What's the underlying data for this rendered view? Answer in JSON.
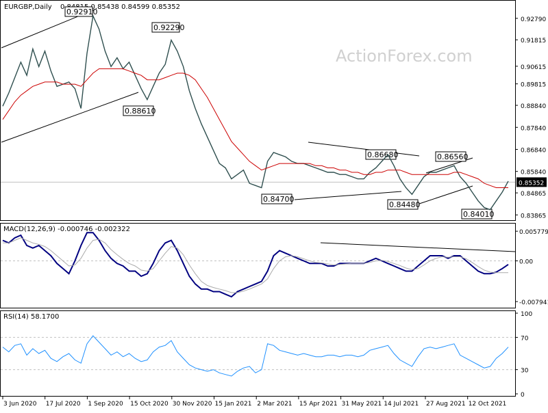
{
  "header": {
    "symbol": "EURGBP,Daily",
    "ohlc": "0.84815 0.85438 0.84599 0.85352"
  },
  "watermark": "ActionForex.com",
  "colors": {
    "price": "#2f4f4f",
    "ma": "#cc0000",
    "macd": "#000080",
    "signal": "#aaaaaa",
    "rsi": "#1e90ff",
    "trend": "#000000",
    "grid": "#c0c0c0",
    "current_box": "#000000"
  },
  "chart_data": [
    {
      "type": "line",
      "panel": "price",
      "ylim": [
        0.8375,
        0.9325
      ],
      "ticks": [
        "0.92790",
        "0.91815",
        "0.90615",
        "0.89815",
        "0.88840",
        "0.87840",
        "0.86840",
        "0.85840",
        "0.84865",
        "0.83865"
      ],
      "current_label": "0.85352",
      "callouts": [
        "0.92910",
        "0.92290",
        "0.88610",
        "0.86680",
        "0.86560",
        "0.84700",
        "0.84480",
        "0.84010"
      ],
      "series": [
        {
          "values": [
            0.888,
            0.894,
            0.901,
            0.908,
            0.902,
            0.914,
            0.906,
            0.913,
            0.904,
            0.897,
            0.898,
            0.899,
            0.896,
            0.887,
            0.912,
            0.929,
            0.923,
            0.913,
            0.906,
            0.91,
            0.905,
            0.908,
            0.902,
            0.896,
            0.891,
            0.897,
            0.903,
            0.907,
            0.918,
            0.913,
            0.906,
            0.895,
            0.887,
            0.88,
            0.874,
            0.868,
            0.862,
            0.86,
            0.855,
            0.857,
            0.859,
            0.853,
            0.852,
            0.851,
            0.863,
            0.867,
            0.866,
            0.865,
            0.863,
            0.862,
            0.862,
            0.861,
            0.86,
            0.859,
            0.858,
            0.858,
            0.857,
            0.857,
            0.856,
            0.855,
            0.855,
            0.858,
            0.86,
            0.863,
            0.866,
            0.861,
            0.855,
            0.851,
            0.848,
            0.852,
            0.856,
            0.858,
            0.858,
            0.859,
            0.86,
            0.861,
            0.856,
            0.853,
            0.849,
            0.845,
            0.842,
            0.841,
            0.845,
            0.849,
            0.854
          ]
        },
        {
          "values": [
            0.882,
            0.886,
            0.89,
            0.893,
            0.895,
            0.897,
            0.898,
            0.899,
            0.899,
            0.899,
            0.898,
            0.898,
            0.898,
            0.897,
            0.9,
            0.903,
            0.905,
            0.905,
            0.905,
            0.905,
            0.905,
            0.904,
            0.903,
            0.902,
            0.9,
            0.9,
            0.9,
            0.901,
            0.902,
            0.903,
            0.903,
            0.902,
            0.9,
            0.896,
            0.892,
            0.887,
            0.882,
            0.877,
            0.872,
            0.869,
            0.866,
            0.863,
            0.861,
            0.859,
            0.86,
            0.861,
            0.862,
            0.862,
            0.862,
            0.862,
            0.862,
            0.862,
            0.861,
            0.861,
            0.86,
            0.86,
            0.859,
            0.859,
            0.858,
            0.858,
            0.857,
            0.857,
            0.858,
            0.858,
            0.859,
            0.859,
            0.859,
            0.858,
            0.857,
            0.857,
            0.857,
            0.857,
            0.857,
            0.857,
            0.857,
            0.858,
            0.858,
            0.857,
            0.856,
            0.855,
            0.853,
            0.852,
            0.851,
            0.851,
            0.851
          ]
        }
      ]
    },
    {
      "type": "line",
      "panel": "macd",
      "title": "MACD(12,26,9) -0.000746 -0.002322",
      "ylim": [
        -0.0086,
        0.0066
      ],
      "ticks": [
        "0.005779",
        "0.00",
        "-0.007941"
      ],
      "series": [
        {
          "values": [
            0.004,
            0.0035,
            0.0045,
            0.005,
            0.003,
            0.0025,
            0.003,
            0.002,
            0.001,
            -0.0005,
            -0.0015,
            -0.0025,
            0.0,
            0.003,
            0.0055,
            0.0055,
            0.004,
            0.002,
            0.0005,
            -0.0005,
            -0.001,
            -0.002,
            -0.002,
            -0.003,
            -0.0025,
            -0.0005,
            0.002,
            0.0035,
            0.004,
            0.002,
            -0.0005,
            -0.003,
            -0.0045,
            -0.0055,
            -0.0055,
            -0.006,
            -0.006,
            -0.0065,
            -0.007,
            -0.006,
            -0.0055,
            -0.005,
            -0.0045,
            -0.004,
            -0.002,
            0.001,
            0.002,
            0.0015,
            0.001,
            0.0005,
            0.0,
            -0.0005,
            -0.0005,
            -0.0005,
            -0.001,
            -0.001,
            -0.0005,
            -0.0005,
            -0.0005,
            -0.0005,
            -0.0005,
            0.0,
            0.0005,
            0.0,
            -0.0005,
            -0.001,
            -0.0015,
            -0.002,
            -0.002,
            -0.001,
            0.0,
            0.001,
            0.001,
            0.001,
            0.0005,
            0.001,
            0.001,
            0.0,
            -0.001,
            -0.002,
            -0.0025,
            -0.0025,
            -0.0022,
            -0.0015,
            -0.0007
          ]
        },
        {
          "values": [
            0.0035,
            0.0035,
            0.004,
            0.0045,
            0.004,
            0.0035,
            0.0032,
            0.0028,
            0.002,
            0.001,
            0.0,
            -0.001,
            -0.0008,
            0.0005,
            0.0025,
            0.004,
            0.0042,
            0.0035,
            0.0022,
            0.0012,
            0.0003,
            -0.0005,
            -0.001,
            -0.0018,
            -0.002,
            -0.0015,
            0.0,
            0.0015,
            0.0028,
            0.0025,
            0.0012,
            -0.0008,
            -0.0025,
            -0.004,
            -0.0048,
            -0.0052,
            -0.0055,
            -0.0058,
            -0.0062,
            -0.0062,
            -0.0059,
            -0.0055,
            -0.005,
            -0.0045,
            -0.0035,
            -0.0015,
            0.0,
            0.0008,
            0.001,
            0.0008,
            0.0004,
            0.0,
            -0.0003,
            -0.0004,
            -0.0006,
            -0.0008,
            -0.0007,
            -0.0006,
            -0.0005,
            -0.0005,
            -0.0005,
            -0.0003,
            0.0,
            0.0001,
            -0.0001,
            -0.0005,
            -0.0009,
            -0.0014,
            -0.0017,
            -0.0015,
            -0.0008,
            0.0,
            0.0005,
            0.0008,
            0.0007,
            0.0008,
            0.0008,
            0.0004,
            -0.0003,
            -0.0011,
            -0.0018,
            -0.0022,
            -0.0023,
            -0.0023,
            -0.0023
          ]
        }
      ]
    },
    {
      "type": "line",
      "panel": "rsi",
      "title": "RSI(14) 58.1700",
      "ylim": [
        0,
        100
      ],
      "ticks": [
        "100",
        "70",
        "30",
        "0"
      ],
      "levels": [
        70,
        30
      ],
      "series": [
        {
          "values": [
            58,
            52,
            60,
            62,
            48,
            56,
            50,
            54,
            44,
            40,
            46,
            50,
            42,
            38,
            62,
            72,
            64,
            56,
            48,
            52,
            46,
            50,
            44,
            40,
            42,
            52,
            58,
            60,
            66,
            52,
            44,
            36,
            32,
            30,
            28,
            30,
            26,
            24,
            22,
            28,
            32,
            34,
            26,
            30,
            62,
            60,
            54,
            52,
            50,
            48,
            50,
            48,
            46,
            46,
            48,
            48,
            46,
            48,
            48,
            46,
            48,
            54,
            56,
            58,
            60,
            50,
            42,
            38,
            34,
            46,
            56,
            58,
            56,
            58,
            60,
            62,
            48,
            44,
            40,
            36,
            32,
            34,
            44,
            50,
            58
          ]
        }
      ]
    }
  ],
  "x_axis_labels": [
    "3 Jun 2020",
    "17 Jul 2020",
    "1 Sep 2020",
    "15 Oct 2020",
    "30 Nov 2020",
    "15 Jan 2021",
    "2 Mar 2021",
    "15 Apr 2021",
    "31 May 2021",
    "14 Jul 2021",
    "27 Aug 2021",
    "12 Oct 2021"
  ]
}
